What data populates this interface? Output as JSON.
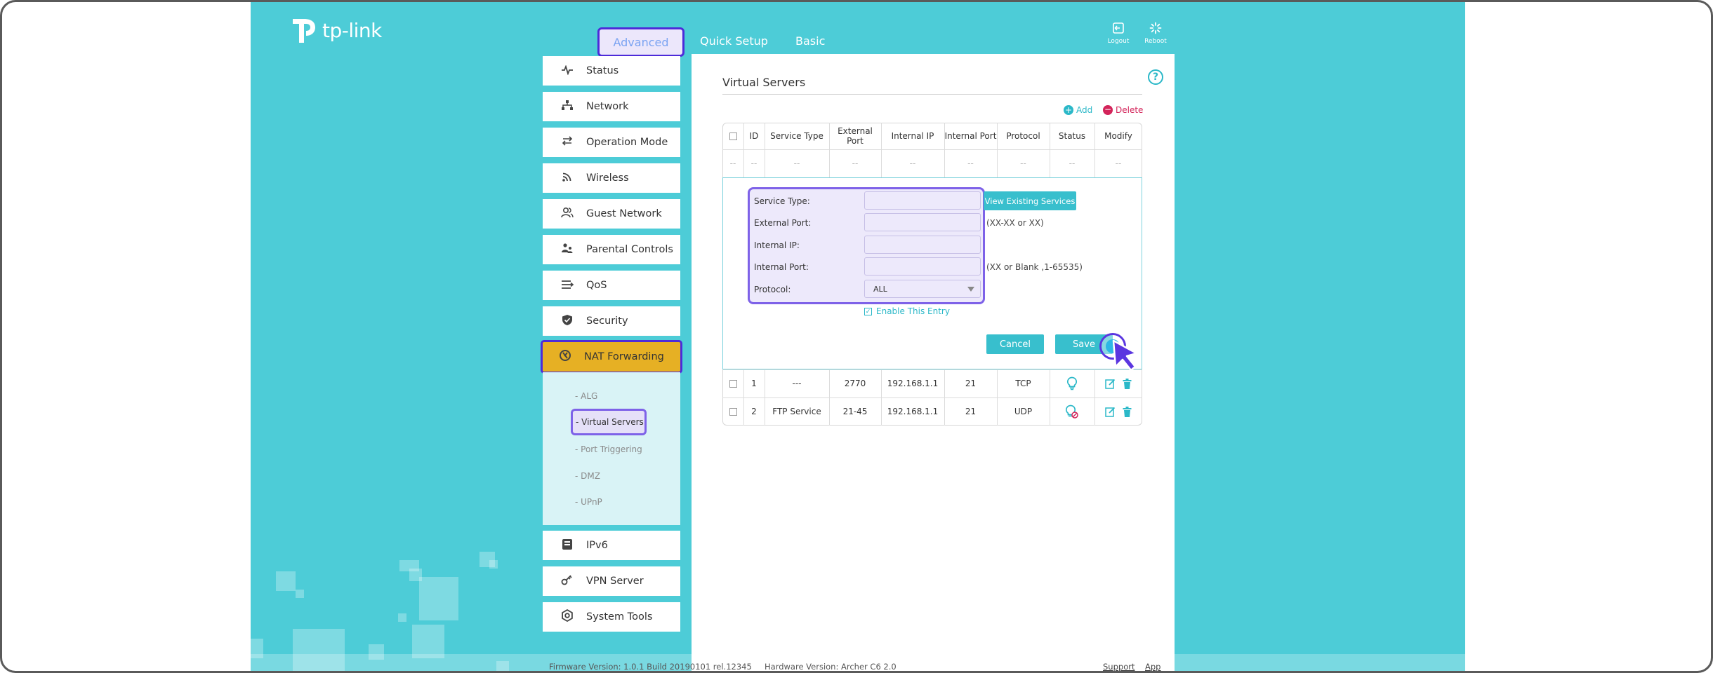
{
  "header": {
    "logo_text": "tp-link",
    "nav": [
      "Quick Setup",
      "Basic",
      "Advanced"
    ],
    "logout_label": "Logout",
    "reboot_label": "Reboot"
  },
  "sidebar": {
    "items": [
      {
        "label": "Status",
        "icon": "pulse-icon"
      },
      {
        "label": "Network",
        "icon": "network-icon"
      },
      {
        "label": "Operation Mode",
        "icon": "operation-mode-icon"
      },
      {
        "label": "Wireless",
        "icon": "wifi-icon"
      },
      {
        "label": "Guest Network",
        "icon": "guest-icon"
      },
      {
        "label": "Parental Controls",
        "icon": "parental-icon"
      },
      {
        "label": "QoS",
        "icon": "qos-icon"
      },
      {
        "label": "Security",
        "icon": "shield-icon"
      },
      {
        "label": "NAT Forwarding",
        "icon": "nat-icon"
      },
      {
        "label": "IPv6",
        "icon": "ipv6-icon"
      },
      {
        "label": "VPN Server",
        "icon": "vpn-icon"
      },
      {
        "label": "System Tools",
        "icon": "gear-icon"
      }
    ],
    "sub_items": [
      "- ALG",
      "- Virtual Servers",
      "- Port Triggering",
      "- DMZ",
      "- UPnP"
    ]
  },
  "main": {
    "title": "Virtual Servers",
    "add_label": "Add",
    "delete_label": "Delete",
    "table": {
      "headers": [
        "ID",
        "Service Type",
        "External Port",
        "Internal IP",
        "Internal Port",
        "Protocol",
        "Status",
        "Modify"
      ],
      "placeholder_row": [
        "--",
        "--",
        "--",
        "--",
        "--",
        "--",
        "--",
        "--",
        "--"
      ],
      "rows": [
        {
          "id": "1",
          "service_type": "---",
          "external_port": "2770",
          "internal_ip": "192.168.1.1",
          "internal_port": "21",
          "protocol": "TCP",
          "status": "enabled"
        },
        {
          "id": "2",
          "service_type": "FTP Service",
          "external_port": "21-45",
          "internal_ip": "192.168.1.1",
          "internal_port": "21",
          "protocol": "UDP",
          "status": "disabled"
        }
      ]
    },
    "form": {
      "service_type_label": "Service Type:",
      "external_port_label": "External Port:",
      "internal_ip_label": "Internal IP:",
      "internal_port_label": "Internal Port:",
      "protocol_label": "Protocol:",
      "protocol_value": "ALL",
      "view_existing_label": "View Existing Services",
      "external_port_hint": "(XX-XX or XX)",
      "internal_port_hint": "(XX or Blank ,1-65535)",
      "enable_label": "Enable This Entry",
      "cancel_label": "Cancel",
      "save_label": "Save"
    }
  },
  "footer": {
    "firmware": "Firmware Version: 1.0.1 Build 20190101 rel.12345",
    "hardware": "Hardware Version: Archer C6 2.0",
    "support": "Support",
    "app": "App"
  },
  "colors": {
    "teal": "#4dccd7",
    "accent": "#38bfcd",
    "active_nav": "#e6b024",
    "highlight": "#4d2bd9",
    "delete": "#d3245a"
  }
}
